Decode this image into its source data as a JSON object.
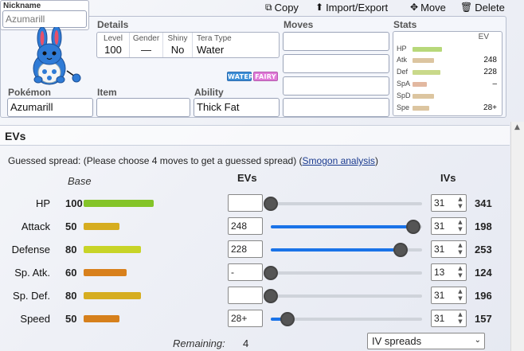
{
  "toolbar": {
    "copy": "Copy",
    "import_export": "Import/Export",
    "move": "Move",
    "delete": "Delete"
  },
  "set": {
    "nickname_label": "Nickname",
    "nickname_placeholder": "Azumarill",
    "details_label": "Details",
    "details": {
      "level_label": "Level",
      "level": "100",
      "gender_label": "Gender",
      "gender": "—",
      "shiny_label": "Shiny",
      "shiny": "No",
      "tera_label": "Tera Type",
      "tera": "Water"
    },
    "types": [
      "WATER",
      "FAIRY"
    ],
    "pokemon_label": "Pokémon",
    "pokemon": "Azumarill",
    "item_label": "Item",
    "item": "",
    "ability_label": "Ability",
    "ability": "Thick Fat",
    "moves_label": "Moves",
    "moves": [
      "",
      "",
      "",
      ""
    ],
    "stats_label": "Stats",
    "stats_ev_label": "EV",
    "stats": [
      {
        "name": "HP",
        "ev": ""
      },
      {
        "name": "Atk",
        "ev": "248"
      },
      {
        "name": "Def",
        "ev": "228"
      },
      {
        "name": "SpA",
        "ev": "–"
      },
      {
        "name": "SpD",
        "ev": ""
      },
      {
        "name": "Spe",
        "ev": "28+"
      }
    ]
  },
  "evs_panel": {
    "title": "EVs",
    "guess_text": "Guessed spread: (Please choose 4 moves to get a guessed spread) (",
    "smogon_link": "Smogon analysis",
    "guess_close": ")",
    "base_header": "Base",
    "evs_header": "EVs",
    "ivs_header": "IVs",
    "rows": [
      {
        "name": "HP",
        "base": "100",
        "ev": "",
        "iv": "31",
        "total": "341",
        "ev_fraction": 0.0,
        "base_fraction": 0.39
      },
      {
        "name": "Attack",
        "base": "50",
        "ev": "248",
        "iv": "31",
        "total": "198",
        "ev_fraction": 0.94,
        "base_fraction": 0.2
      },
      {
        "name": "Defense",
        "base": "80",
        "ev": "228",
        "iv": "31",
        "total": "253",
        "ev_fraction": 0.86,
        "base_fraction": 0.32
      },
      {
        "name": "Sp. Atk.",
        "base": "60",
        "ev": "-",
        "iv": "13",
        "total": "124",
        "ev_fraction": 0.0,
        "base_fraction": 0.24
      },
      {
        "name": "Sp. Def.",
        "base": "80",
        "ev": "",
        "iv": "31",
        "total": "196",
        "ev_fraction": 0.0,
        "base_fraction": 0.32
      },
      {
        "name": "Speed",
        "base": "50",
        "ev": "28+",
        "iv": "31",
        "total": "157",
        "ev_fraction": 0.11,
        "base_fraction": 0.2
      }
    ],
    "remaining_label": "Remaining:",
    "remaining_value": "4",
    "iv_spreads_select": "IV spreads"
  },
  "colors": {
    "water": "#3d8fd6",
    "fairy": "#e07ad8",
    "slider_blue": "#1a73e8"
  }
}
